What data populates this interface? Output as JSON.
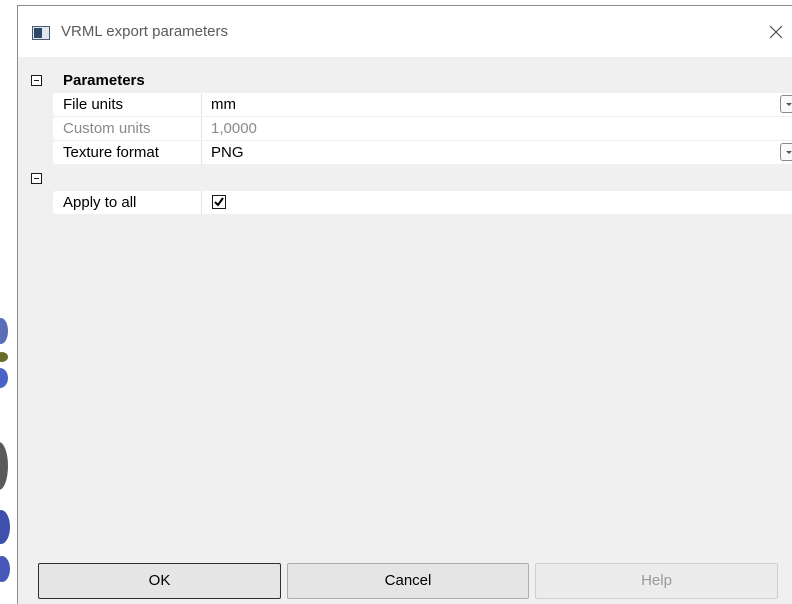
{
  "dialog": {
    "title": "VRML export parameters"
  },
  "groups": [
    {
      "title": "Parameters",
      "rows": [
        {
          "name": "File units",
          "value": "mm"
        },
        {
          "name": "Custom units",
          "value": "1,0000"
        },
        {
          "name": "Texture format",
          "value": "PNG"
        }
      ]
    },
    {
      "title": "",
      "rows": [
        {
          "name": "Apply to all",
          "checked": true
        }
      ]
    }
  ],
  "buttons": {
    "ok": "OK",
    "cancel": "Cancel",
    "help": "Help"
  },
  "icons": {
    "title": "window-icon",
    "close": "close-icon",
    "collapse": "collapse-minus-icon",
    "dropdown": "dropdown-arrow-icon",
    "check": "check-icon"
  },
  "colors": {
    "dialog_bg": "#f0f0f0",
    "titlebar_bg": "#ffffff",
    "row_bg": "#ffffff",
    "disabled_text": "#8a8a8a"
  }
}
